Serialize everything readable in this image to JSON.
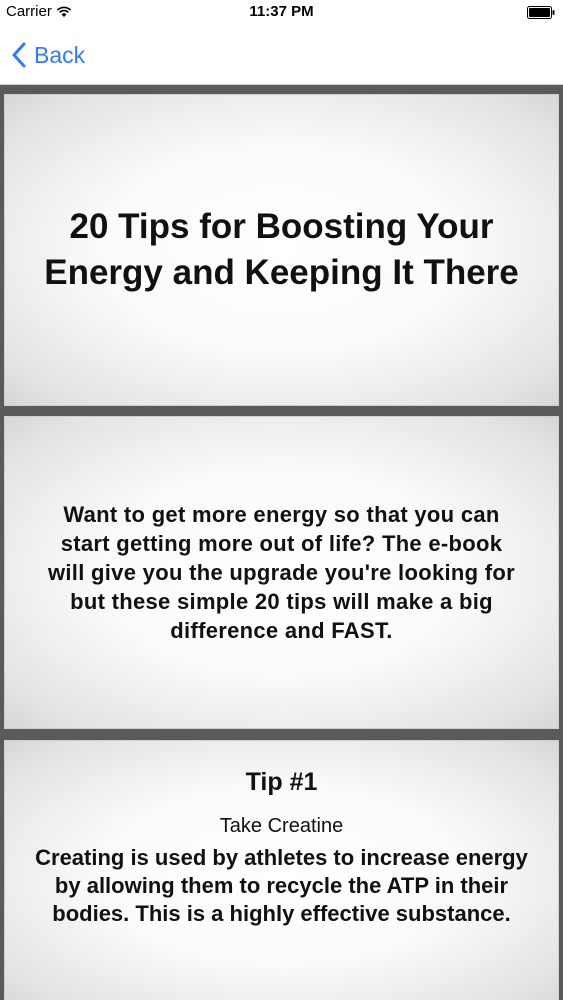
{
  "status_bar": {
    "carrier": "Carrier",
    "time": "11:37 PM",
    "wifi_icon": "wifi-icon",
    "battery_icon": "battery-icon"
  },
  "nav": {
    "back_label": "Back",
    "back_icon": "chevron-left-icon",
    "accent_color": "#2f7cf6"
  },
  "cards": {
    "title": "20 Tips for Boosting Your Energy and Keeping It There",
    "intro": "Want to get more energy so that you can start getting more out of life? The e-book will give you the upgrade you're looking for but these simple 20 tips will make a big difference and FAST.",
    "tip": {
      "heading": "Tip #1",
      "subheading": "Take Creatine",
      "body": "Creating is used by athletes to increase energy by allowing them to recycle the ATP in their bodies. This is a highly effective substance."
    }
  }
}
